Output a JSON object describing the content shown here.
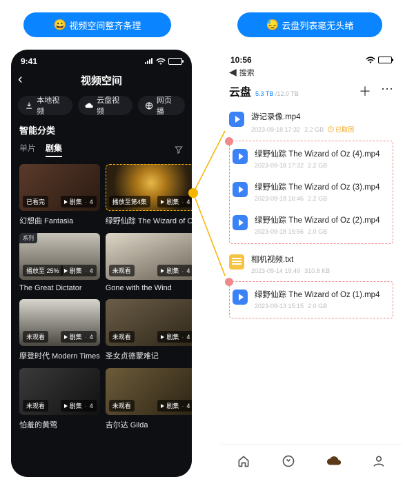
{
  "pills": {
    "left": {
      "emoji": "😀",
      "text": "视频空间整齐条理"
    },
    "right": {
      "emoji": "😓",
      "text": "云盘列表毫无头绪"
    }
  },
  "left_phone": {
    "status_time": "9:41",
    "back_icon": "‹",
    "header_title": "视频空间",
    "chips": {
      "local": "本地视频",
      "cloud": "云盘视频",
      "web": "网页播"
    },
    "section_title": "智能分类",
    "tabs": {
      "single": "单片",
      "series": "剧集"
    },
    "cards": [
      {
        "left_badge": "已看完",
        "right_label": "剧集",
        "right_count": "4",
        "title": "幻想曲 Fantasia",
        "tag": ""
      },
      {
        "left_badge": "播放至第4集",
        "right_label": "剧集",
        "right_count": "4",
        "title": "绿野仙踪 The Wizard of Oz",
        "tag": ""
      },
      {
        "left_badge": "播放至 25%",
        "right_label": "剧集",
        "right_count": "4",
        "title": "The Great Dictator",
        "tag": "系列"
      },
      {
        "left_badge": "未观看",
        "right_label": "剧集",
        "right_count": "4",
        "title": "Gone with the Wind",
        "tag": ""
      },
      {
        "left_badge": "未观看",
        "right_label": "剧集",
        "right_count": "4",
        "title": "摩登时代 Modern Times",
        "tag": ""
      },
      {
        "left_badge": "未观看",
        "right_label": "剧集",
        "right_count": "4",
        "title": "圣女贞德蒙难记",
        "tag": ""
      },
      {
        "left_badge": "未观看",
        "right_label": "剧集",
        "right_count": "4",
        "title": "怕羞的黄莺",
        "tag": ""
      },
      {
        "left_badge": "未观看",
        "right_label": "剧集",
        "right_count": "4",
        "title": "吉尔达 Gilda",
        "tag": ""
      }
    ]
  },
  "right_phone": {
    "status_time": "10:56",
    "search_label": "搜索",
    "title": "云盘",
    "storage_used": "5.3 TB",
    "storage_sep": " /",
    "storage_total": "12.0 TB",
    "recall_label": "已取回",
    "files_top": [
      {
        "name": "游记录像.mp4",
        "date": "2023-09-18 17:32",
        "size": "2.2 GB",
        "recall": true
      }
    ],
    "files_group1": [
      {
        "name": "绿野仙踪 The Wizard of Oz (4).mp4",
        "date": "2023-09-18 17:32",
        "size": "2.2 GB"
      },
      {
        "name": "绿野仙踪 The Wizard of Oz (3).mp4",
        "date": "2023-09-18 16:46",
        "size": "2.2 GB"
      },
      {
        "name": "绿野仙踪 The Wizard of Oz (2).mp4",
        "date": "2023-09-18 15:56",
        "size": "2.0 GB"
      }
    ],
    "files_mid": [
      {
        "name": "相机视频.txt",
        "date": "2023-09-14 19:49",
        "size": "310.8 KB"
      }
    ],
    "files_group2": [
      {
        "name": "绿野仙踪 The Wizard of Oz (1).mp4",
        "date": "2023-09-13 15:15",
        "size": "2.0 GB"
      }
    ]
  }
}
